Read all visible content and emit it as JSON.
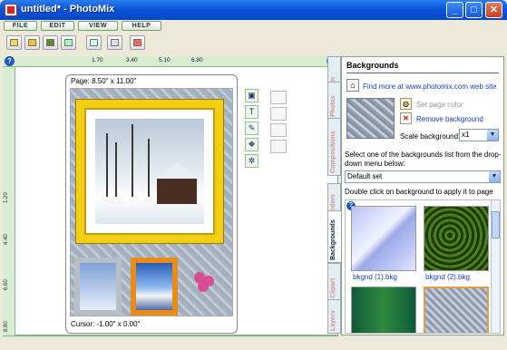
{
  "window": {
    "title": "untitled* - PhotoMix",
    "min": "_",
    "max": "□",
    "close": "✕"
  },
  "menu": [
    "FILE",
    "EDIT",
    "VIEW",
    "HELP"
  ],
  "toolbar_icons": [
    "new-icon",
    "open-icon",
    "save-icon",
    "print-icon",
    "undo-icon",
    "redo-icon",
    "help-icon"
  ],
  "ruler": {
    "help": "?",
    "marks": [
      "1.70",
      "3.40",
      "5.10",
      "6.80"
    ]
  },
  "vruler": [
    "1.20",
    "4.40",
    "6.60",
    "8.80"
  ],
  "page": {
    "size": "Page: 8.50\" x 11.00\"",
    "cursor": "Cursor: -1.00\" x 0.00\""
  },
  "tabs": [
    "Main",
    "Photos",
    "Compositions",
    "Borders",
    "Backgrounds",
    "Clipart",
    "Layers"
  ],
  "panel": {
    "title": "Backgrounds",
    "find_more": "Find more at www.photomix.com web site",
    "set_page_color": "Set page color",
    "remove_background": "Remove background",
    "scale_label": "Scale background:",
    "scale_value": "x1",
    "select_text": "Select one of the backgrounds list from the drop-down menu below:",
    "set_value": "Default set",
    "dblclick": "Double click on background to apply it to page",
    "grid_help": "?",
    "thumbs": [
      "bkgnd (1).bkg",
      "bkgnd (2).bkg"
    ]
  }
}
